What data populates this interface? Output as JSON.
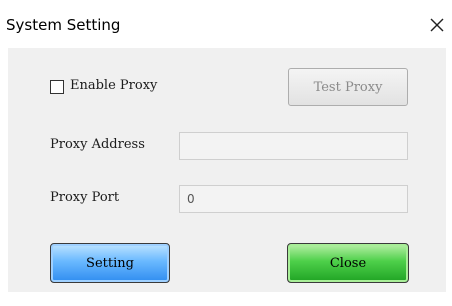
{
  "window": {
    "title": "System Setting",
    "close_icon": "close-icon"
  },
  "proxy": {
    "enable_label": "Enable Proxy",
    "enable_checked": false,
    "test_button_label": "Test Proxy",
    "address_label": "Proxy Address",
    "address_value": "",
    "port_label": "Proxy Port",
    "port_value": "0"
  },
  "footer": {
    "setting_label": "Setting",
    "close_label": "Close"
  },
  "colors": {
    "setting_button": "#2f8cf0",
    "close_button": "#1fa324",
    "client_background": "#f0f0f0"
  }
}
